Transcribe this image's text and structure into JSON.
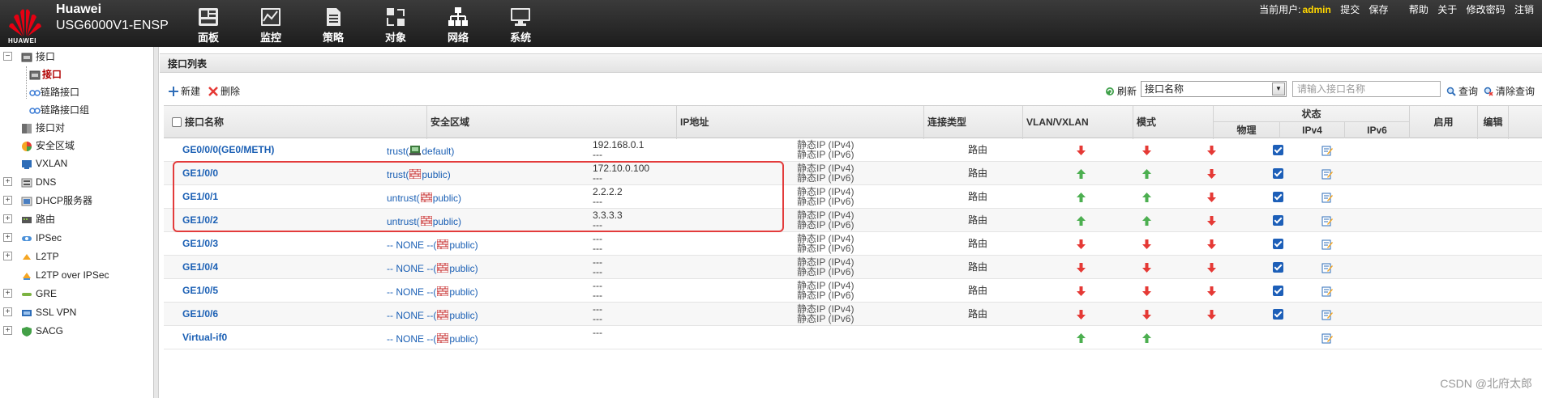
{
  "header": {
    "brand": "Huawei",
    "model": "USG6000V1-ENSP",
    "logo_text": "HUAWEI",
    "nav": [
      {
        "label": "面板",
        "icon": "dashboard-icon"
      },
      {
        "label": "监控",
        "icon": "monitor-icon"
      },
      {
        "label": "策略",
        "icon": "policy-icon"
      },
      {
        "label": "对象",
        "icon": "object-icon"
      },
      {
        "label": "网络",
        "icon": "network-icon"
      },
      {
        "label": "系统",
        "icon": "system-icon"
      }
    ],
    "current_user_label": "当前用户:",
    "current_user": "admin",
    "links": [
      "提交",
      "保存",
      "帮助",
      "关于",
      "修改密码",
      "注销"
    ],
    "user_color": "#ffd600"
  },
  "sidebar": {
    "items": [
      {
        "label": "接口",
        "expander": "−"
      },
      {
        "label": "接口"
      },
      {
        "label": "链路接口"
      },
      {
        "label": "链路接口组"
      },
      {
        "label": "接口对"
      },
      {
        "label": "安全区域"
      },
      {
        "label": "VXLAN"
      },
      {
        "label": "DNS",
        "expander": "+"
      },
      {
        "label": "DHCP服务器",
        "expander": "+"
      },
      {
        "label": "路由",
        "expander": "+"
      },
      {
        "label": "IPSec",
        "expander": "+"
      },
      {
        "label": "L2TP",
        "expander": "+"
      },
      {
        "label": "L2TP over IPSec"
      },
      {
        "label": "GRE",
        "expander": "+"
      },
      {
        "label": "SSL VPN",
        "expander": "+"
      },
      {
        "label": "SACG",
        "expander": "+"
      }
    ],
    "active_color": "#b00000"
  },
  "panel": {
    "title": "接口列表",
    "toolbar": {
      "new_label": "新建",
      "delete_label": "删除",
      "refresh_label": "刷新",
      "filter_selected": "接口名称",
      "search_placeholder": "请输入接口名称",
      "query_label": "查询",
      "clear_label": "清除查询"
    }
  },
  "table": {
    "headers": {
      "name": "接口名称",
      "zone": "安全区域",
      "ip": "IP地址",
      "conn": "连接类型",
      "vlan": "VLAN/VXLAN",
      "mode": "模式",
      "status": "状态",
      "physical": "物理",
      "ipv4": "IPv4",
      "ipv6": "IPv6",
      "enable": "启用",
      "edit": "编辑"
    },
    "rows": [
      {
        "name": "GE0/0/0(GE0/METH)",
        "zone_prefix": "trust(",
        "zone_icon": "server-icon",
        "zone_suffix": "default)",
        "ip1": "192.168.0.1",
        "ip2": "---",
        "conn1": "静态IP (IPv4)",
        "conn2": "静态IP (IPv6)",
        "mode": "路由",
        "phys": "down",
        "ipv4": "down",
        "ipv6": "down",
        "enabled": true
      },
      {
        "name": "GE1/0/0",
        "zone_prefix": "trust(",
        "zone_icon": "firewall-icon",
        "zone_suffix": "public)",
        "ip1": "172.10.0.100",
        "ip2": "---",
        "conn1": "静态IP (IPv4)",
        "conn2": "静态IP (IPv6)",
        "mode": "路由",
        "phys": "up",
        "ipv4": "up",
        "ipv6": "down",
        "enabled": true
      },
      {
        "name": "GE1/0/1",
        "zone_prefix": "untrust(",
        "zone_icon": "firewall-icon",
        "zone_suffix": "public)",
        "ip1": "2.2.2.2",
        "ip2": "---",
        "conn1": "静态IP (IPv4)",
        "conn2": "静态IP (IPv6)",
        "mode": "路由",
        "phys": "up",
        "ipv4": "up",
        "ipv6": "down",
        "enabled": true
      },
      {
        "name": "GE1/0/2",
        "zone_prefix": "untrust(",
        "zone_icon": "firewall-icon",
        "zone_suffix": "public)",
        "ip1": "3.3.3.3",
        "ip2": "---",
        "conn1": "静态IP (IPv4)",
        "conn2": "静态IP (IPv6)",
        "mode": "路由",
        "phys": "up",
        "ipv4": "up",
        "ipv6": "down",
        "enabled": true
      },
      {
        "name": "GE1/0/3",
        "zone_prefix": "-- NONE --(",
        "zone_icon": "firewall-icon",
        "zone_suffix": "public)",
        "ip1": "---",
        "ip2": "---",
        "conn1": "静态IP (IPv4)",
        "conn2": "静态IP (IPv6)",
        "mode": "路由",
        "phys": "down",
        "ipv4": "down",
        "ipv6": "down",
        "enabled": true
      },
      {
        "name": "GE1/0/4",
        "zone_prefix": "-- NONE --(",
        "zone_icon": "firewall-icon",
        "zone_suffix": "public)",
        "ip1": "---",
        "ip2": "---",
        "conn1": "静态IP (IPv4)",
        "conn2": "静态IP (IPv6)",
        "mode": "路由",
        "phys": "down",
        "ipv4": "down",
        "ipv6": "down",
        "enabled": true
      },
      {
        "name": "GE1/0/5",
        "zone_prefix": "-- NONE --(",
        "zone_icon": "firewall-icon",
        "zone_suffix": "public)",
        "ip1": "---",
        "ip2": "---",
        "conn1": "静态IP (IPv4)",
        "conn2": "静态IP (IPv6)",
        "mode": "路由",
        "phys": "down",
        "ipv4": "down",
        "ipv6": "down",
        "enabled": true
      },
      {
        "name": "GE1/0/6",
        "zone_prefix": "-- NONE --(",
        "zone_icon": "firewall-icon",
        "zone_suffix": "public)",
        "ip1": "---",
        "ip2": "---",
        "conn1": "静态IP (IPv4)",
        "conn2": "静态IP (IPv6)",
        "mode": "路由",
        "phys": "down",
        "ipv4": "down",
        "ipv6": "down",
        "enabled": true
      },
      {
        "name": "Virtual-if0",
        "zone_prefix": "-- NONE --(",
        "zone_icon": "firewall-icon",
        "zone_suffix": "public)",
        "ip1": "---",
        "ip2": "",
        "conn1": "",
        "conn2": "",
        "mode": "",
        "phys": "up",
        "ipv4": "up",
        "ipv6": "",
        "enabled": false
      }
    ],
    "colors": {
      "up": "#4caf50",
      "down": "#e53935",
      "link": "#1a5fb4",
      "highlight": "#e33b3b"
    }
  },
  "watermark": "CSDN @北府太郎"
}
